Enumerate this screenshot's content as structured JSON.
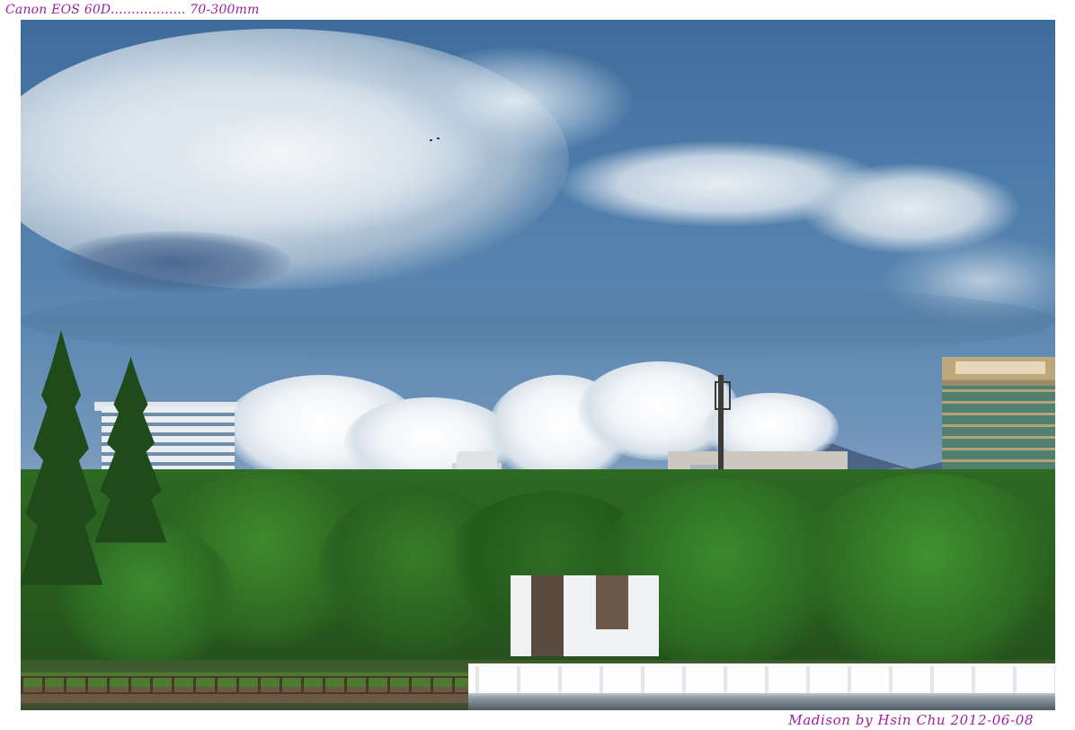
{
  "captions": {
    "camera": "Canon EOS 60D.................. 70-300mm",
    "signature": "Madison by Hsin Chu 2012-06-08"
  },
  "photo": {
    "scene": "park-skyline",
    "colors": {
      "sky": "#5d88b2",
      "foliage": "#2d6a22",
      "caption": "#9b1fa0"
    }
  }
}
